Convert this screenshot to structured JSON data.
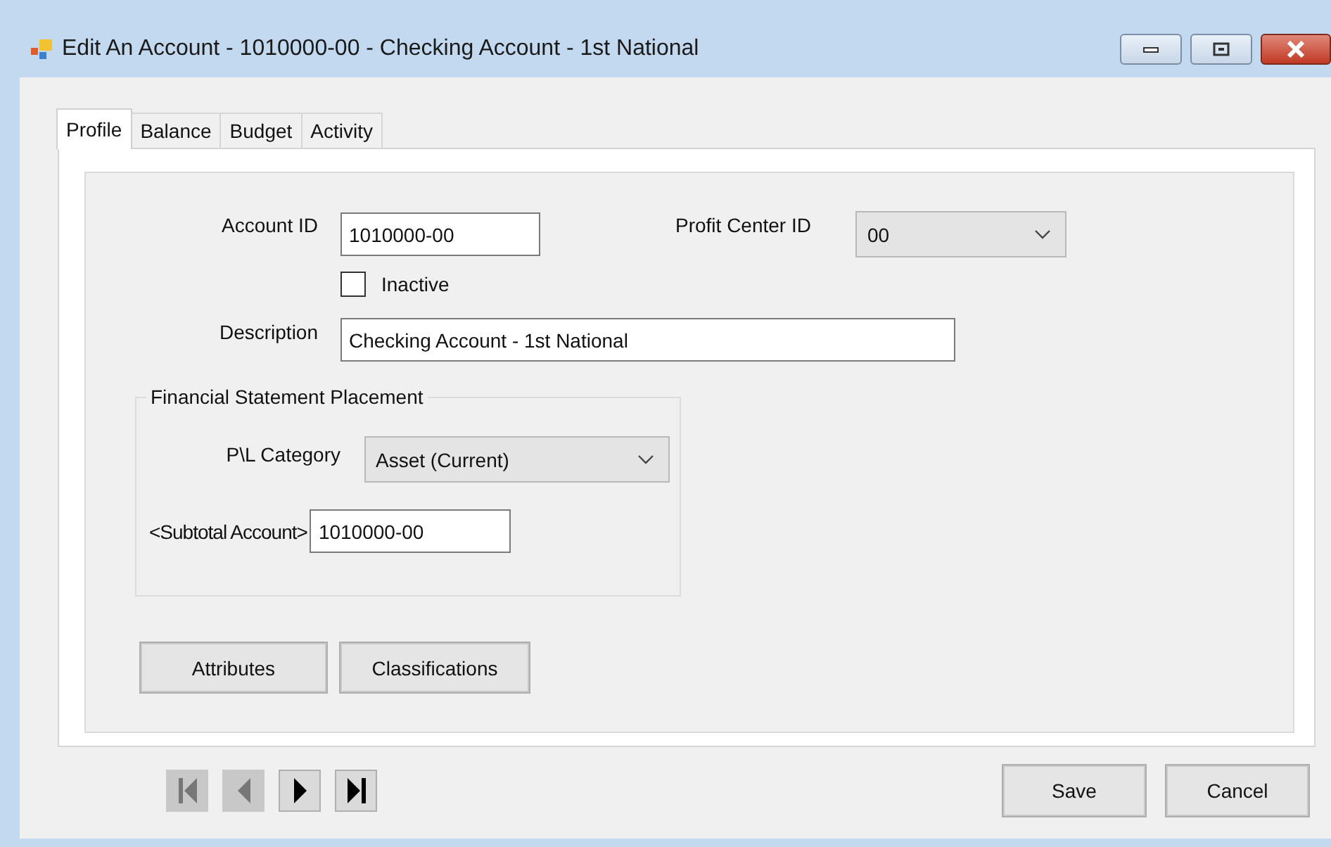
{
  "window": {
    "title": "Edit An Account - 1010000-00 - Checking Account - 1st National"
  },
  "tabs": [
    {
      "label": "Profile",
      "selected": true
    },
    {
      "label": "Balance",
      "selected": false
    },
    {
      "label": "Budget",
      "selected": false
    },
    {
      "label": "Activity",
      "selected": false
    }
  ],
  "account_id": {
    "label": "Account ID",
    "value": "1010000-00"
  },
  "profit_center": {
    "label": "Profit Center ID",
    "value": "00"
  },
  "inactive": {
    "label": "Inactive",
    "checked": false
  },
  "description": {
    "label": "Description",
    "value": "Checking Account - 1st National"
  },
  "placement": {
    "title": "Financial Statement Placement",
    "category": {
      "label": "P\\L Category",
      "value": "Asset (Current)"
    },
    "subtotal": {
      "label": "<Subtotal Account>",
      "value": "1010000-00"
    }
  },
  "buttons": [
    "Attributes",
    "Classifications"
  ],
  "navigation": [
    {
      "kind": "first",
      "disabled": true
    },
    {
      "kind": "previous",
      "disabled": true
    },
    {
      "kind": "next",
      "disabled": false
    },
    {
      "kind": "last",
      "disabled": false
    }
  ],
  "actions": [
    "Save",
    "Cancel"
  ]
}
